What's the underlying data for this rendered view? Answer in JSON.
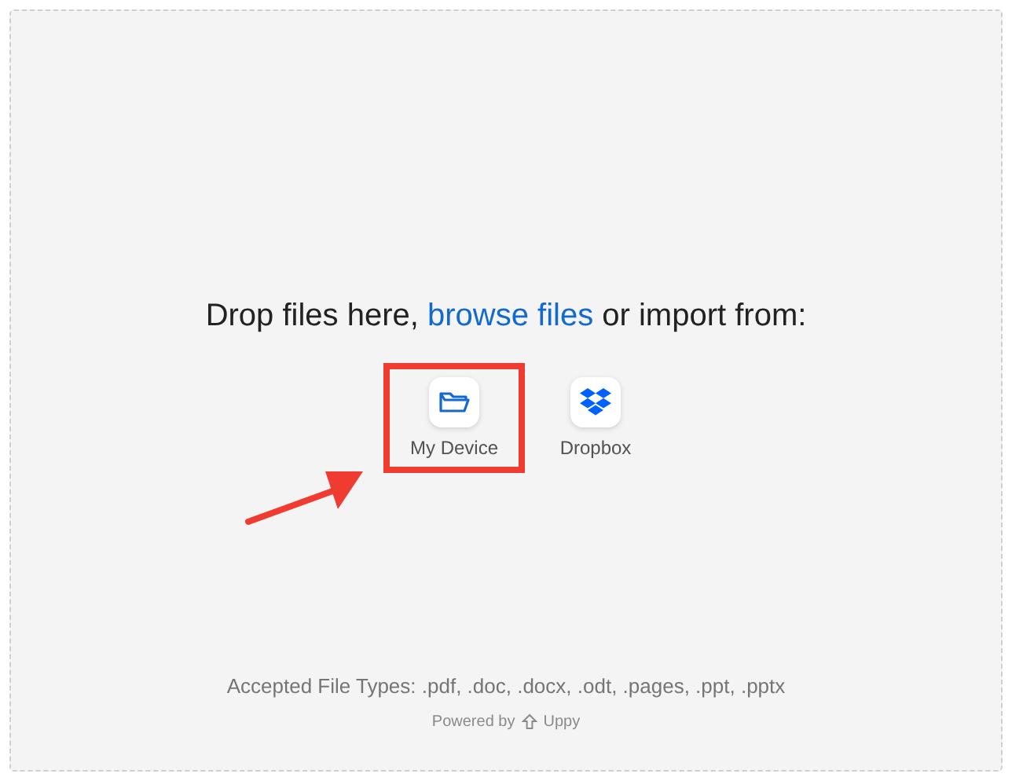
{
  "dropzone": {
    "title": "Drop files here, ",
    "link": "browse files",
    "title_end": " or import from:",
    "sources": [
      {
        "label": "My Device",
        "kind": "device",
        "highlighted": true
      },
      {
        "label": "Dropbox",
        "kind": "dropbox",
        "highlighted": false
      }
    ],
    "accepted": "Accepted File Types: .pdf, .doc, .docx, .odt, .pages, .ppt, .pptx",
    "powered_by": "Powered by",
    "brand": "Uppy"
  }
}
